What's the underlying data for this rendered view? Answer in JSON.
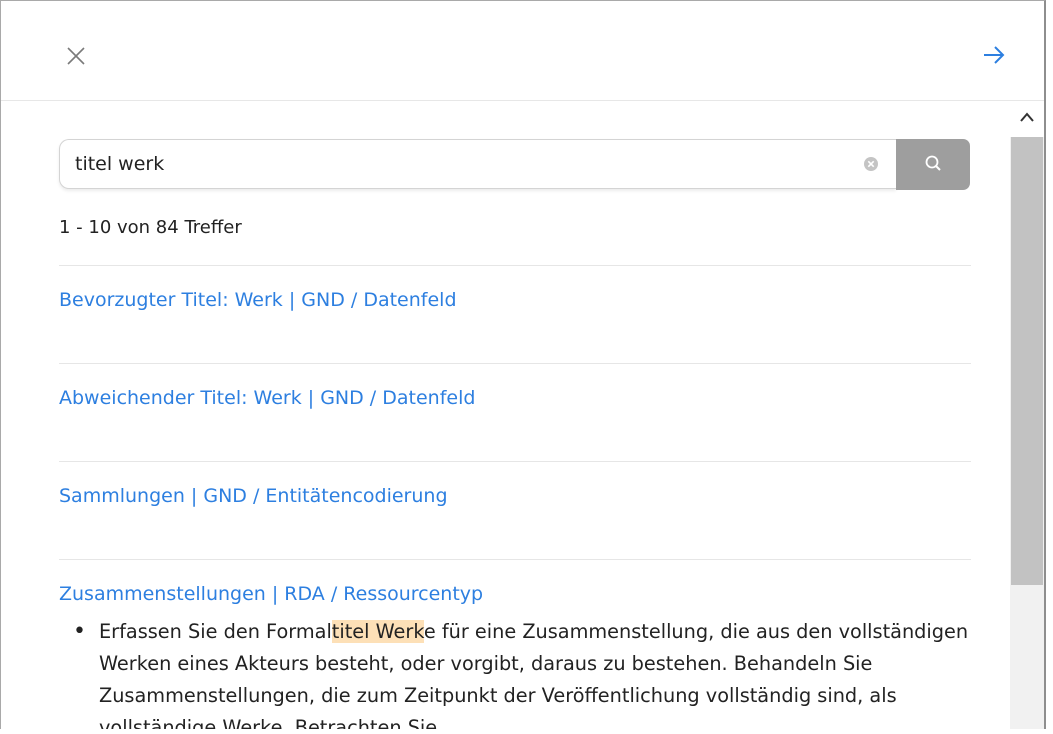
{
  "header": {
    "close_icon": "close-icon",
    "forward_icon": "arrow-right-icon",
    "accent_color": "#2d7fe0"
  },
  "search": {
    "value": "titel werk",
    "clear_icon": "clear-circle-icon",
    "button_icon": "search-icon"
  },
  "results": {
    "count_text": "1 - 10 von 84 Treffer",
    "items": [
      {
        "title": "Bevorzugter Titel: Werk | GND / Datenfeld"
      },
      {
        "title": "Abweichender Titel: Werk | GND / Datenfeld"
      },
      {
        "title": "Sammlungen | GND / Entitätencodierung"
      },
      {
        "title": "Zusammenstellungen | RDA / Ressourcentyp",
        "snippet_before": "Erfassen Sie den Formal",
        "snippet_highlight": "titel Werk",
        "snippet_after": "e für eine Zusammenstellung, die aus den vollständigen Werken eines Akteurs besteht, oder vorgibt, daraus zu bestehen. Behandeln Sie Zusammenstellungen, die zum Zeitpunkt der Veröffentlichung vollständig sind, als vollständige Werke. Betrachten Sie"
      }
    ]
  },
  "scrollbar": {
    "up_icon": "chevron-up-icon",
    "position_fraction": 0.0
  }
}
